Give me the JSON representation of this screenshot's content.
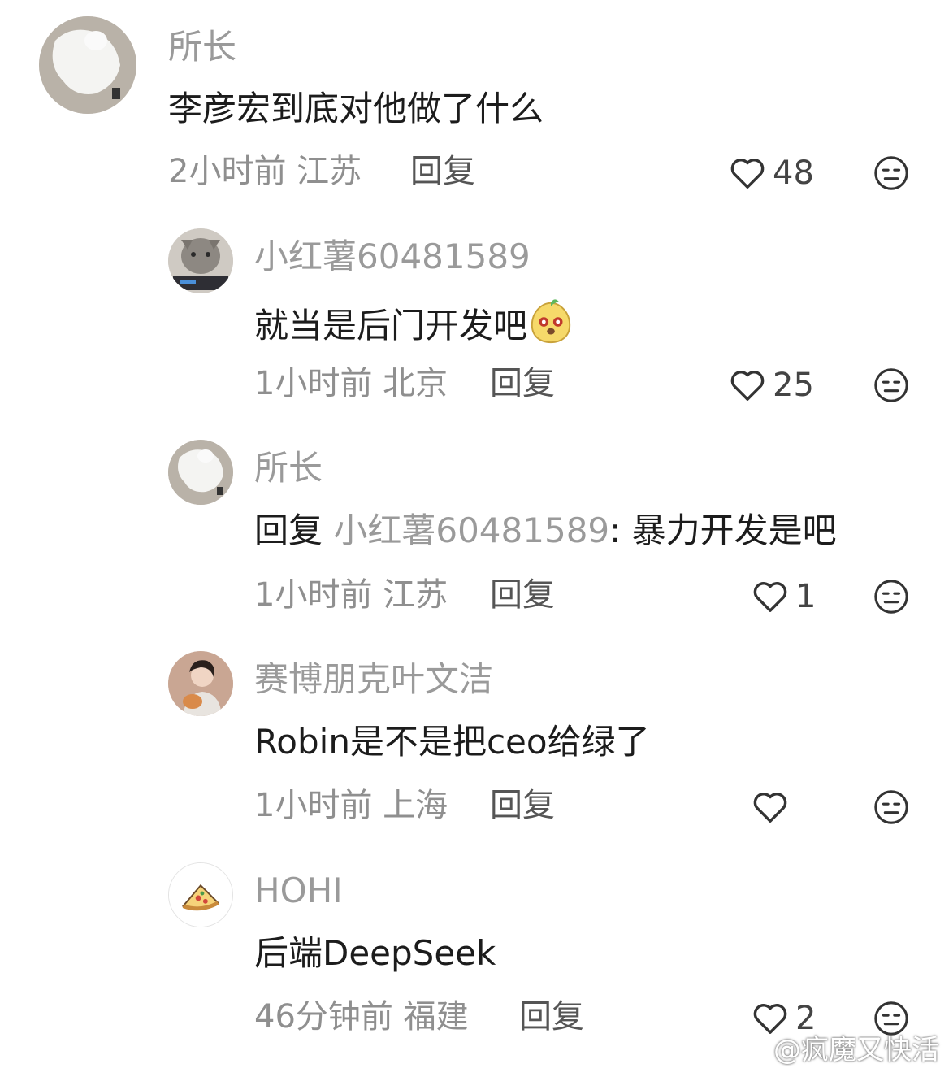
{
  "comments": [
    {
      "name": "所长",
      "text": "李彦宏到底对他做了什么",
      "time_location": "2小时前 江苏",
      "reply_label": "回复",
      "likes": "48",
      "avatar": "white-cat-avatar"
    },
    {
      "name": "小红薯60481589",
      "text": "就当是后门开发吧",
      "emoji": "happy-face-sticker",
      "time_location": "1小时前 北京",
      "reply_label": "回复",
      "likes": "25",
      "avatar": "grey-cat-avatar"
    },
    {
      "name": "所长",
      "text_prefix": "回复 ",
      "text_quoted": "小红薯60481589",
      "text_suffix": ": 暴力开发是吧",
      "time_location": "1小时前 江苏",
      "reply_label": "回复",
      "likes": "1",
      "avatar": "white-cat-avatar"
    },
    {
      "name": "赛博朋克叶文洁",
      "text": "Robin是不是把ceo给绿了",
      "time_location": "1小时前 上海",
      "reply_label": "回复",
      "likes": "",
      "avatar": "portrait-avatar"
    },
    {
      "name": "HOHI",
      "text": "后端DeepSeek",
      "time_location": "46分钟前 福建",
      "reply_label": "回复",
      "likes": "2",
      "avatar": "pizza-avatar"
    }
  ],
  "watermark": "@疯魔又快活",
  "colors": {
    "name": "#9a9a9a",
    "text": "#1c1c1c",
    "meta": "#8f8f8f",
    "icon": "#333333"
  }
}
